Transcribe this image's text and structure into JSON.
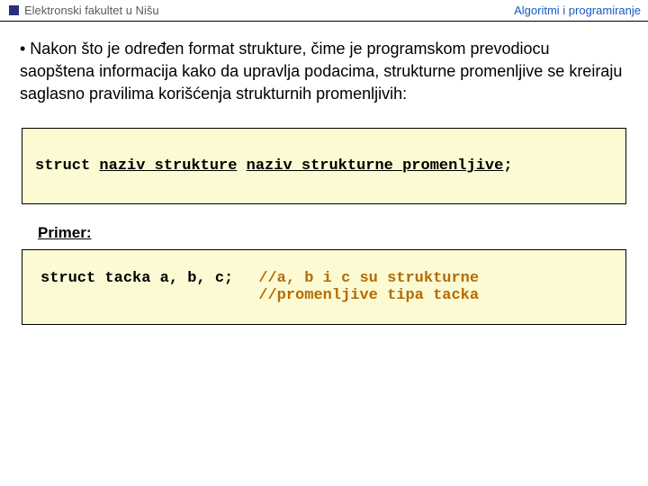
{
  "header": {
    "left": "Elektronski fakultet u Nišu",
    "right": "Algoritmi i programiranje"
  },
  "paragraph": "• Nakon što je određen format strukture, čime je programskom prevodiocu saopštena informacija kako da upravlja podacima, strukturne promenljive se kreiraju saglasno pravilima korišćenja strukturnih promenljivih:",
  "code1": {
    "keyword": "struct ",
    "name1": "naziv_strukture",
    "sep": " ",
    "name2": "naziv_strukturne_promenljive",
    "end": ";"
  },
  "example_label": "Primer:",
  "code2": {
    "left": "struct tacka a, b, c;",
    "right_line1": "//a, b i c su strukturne",
    "right_line2": "//promenljive tipa tacka"
  }
}
